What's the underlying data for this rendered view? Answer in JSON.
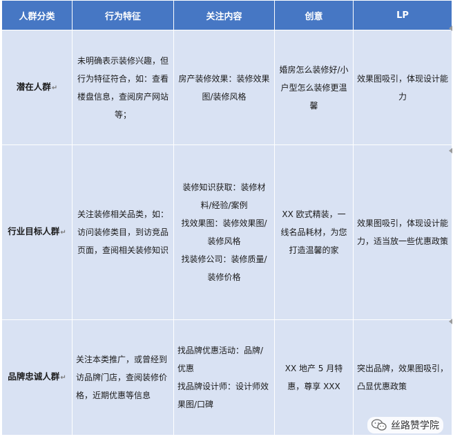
{
  "columns": [
    "人群分类",
    "行为特征",
    "关注内容",
    "创意",
    "LP"
  ],
  "rows": [
    {
      "segment": "潜在人群",
      "behavior": [
        "未明确表示装修兴趣，但行为特征符合，如：查看楼盘信息，查阅房产网站等；"
      ],
      "focus": [
        "房产装修效果：装修效果图/装修风格"
      ],
      "creative": [
        "婚房怎么装修好/小户型怎么装修更温馨"
      ],
      "lp": [
        "效果图吸引，体现设计能力"
      ]
    },
    {
      "segment": "行业目标人群",
      "behavior": [
        "关注装修相关品类，如：访问装修类目，到访竞品页面，查阅相关装修知识"
      ],
      "focus": [
        "装修知识获取：装修材料/经验/案例",
        "找效果图：装修效果图/装修风格",
        "找装修公司：装修质量/装修价格"
      ],
      "creative": [
        "XX 欧式精装，一线名品耗材，为您打造温馨的家"
      ],
      "lp": [
        "效果图吸引，体现设计能力，适当放一些优惠政策"
      ]
    },
    {
      "segment": "品牌忠诚人群",
      "behavior": [
        "关注本类推广，或曾经到访品牌门店，查阅装修价格，近期优惠等信息"
      ],
      "focus": [
        "找品牌优惠活动：品牌/优惠",
        "找品牌设计师：设计师效果图/口碑"
      ],
      "creative": [
        "XX 地产 5 月特惠，尊享 XXX"
      ],
      "lp": [
        "突出品牌，效果图吸引，凸显优惠政策"
      ]
    }
  ],
  "watermark": "丝路赞学院"
}
